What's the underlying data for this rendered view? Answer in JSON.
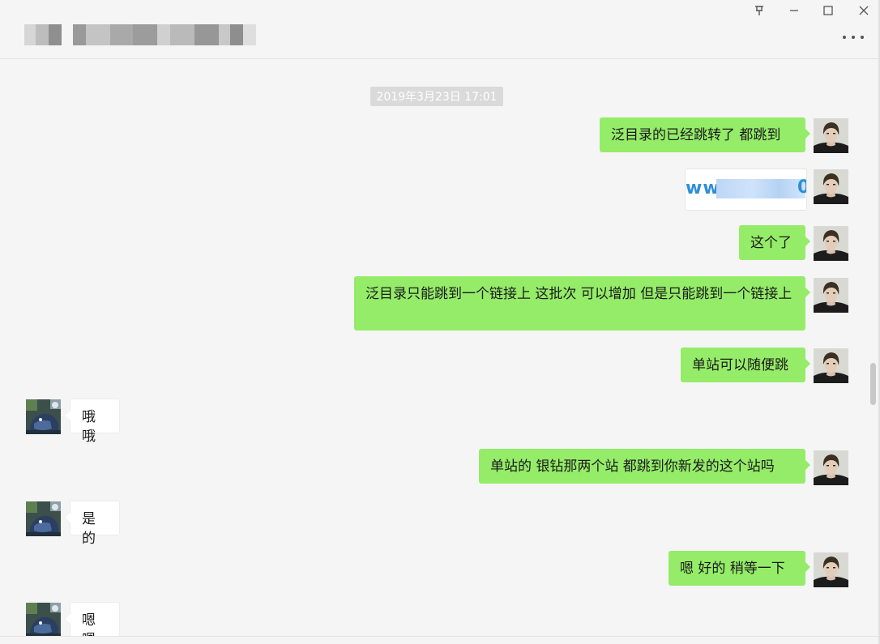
{
  "window": {
    "pin_icon": "pin-icon",
    "minimize_glyph": "—",
    "maximize_glyph": "☐",
    "close_glyph": "✕",
    "more_icon": "more-dots-icon"
  },
  "chat": {
    "timestamp": "2019年3月23日 17:01",
    "link_card": {
      "prefix": "ww.",
      "suffix": "0"
    },
    "messages": [
      {
        "side": "me",
        "text": "泛目录的已经跳转了 都跳到"
      },
      {
        "side": "me",
        "type": "link"
      },
      {
        "side": "me",
        "text": "这个了"
      },
      {
        "side": "me",
        "text": "泛目录只能跳到一个链接上 这批次 可以增加 但是只能跳到一个链接上"
      },
      {
        "side": "me",
        "text": "单站可以随便跳"
      },
      {
        "side": "them",
        "text": "哦哦"
      },
      {
        "side": "me",
        "text": "单站的 银钻那两个站 都跳到你新发的这个站吗"
      },
      {
        "side": "them",
        "text": "是的"
      },
      {
        "side": "me",
        "text": "嗯 好的 稍等一下"
      },
      {
        "side": "them",
        "text": "嗯嗯"
      }
    ]
  },
  "colors": {
    "my_bubble": "#95ec69",
    "their_bubble": "#ffffff",
    "background": "#f5f5f5",
    "timestamp_bg": "#dadada",
    "link_text": "#2f8fd8"
  }
}
